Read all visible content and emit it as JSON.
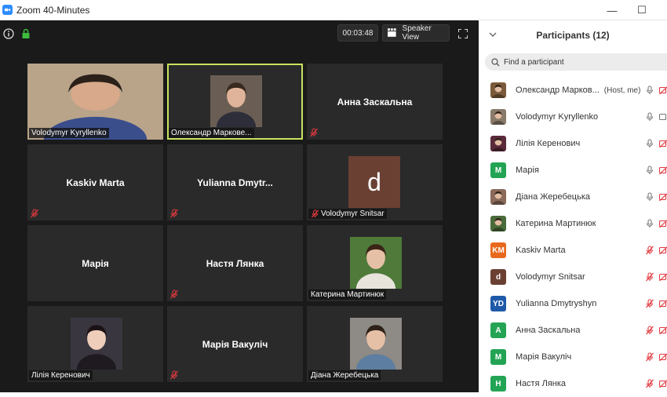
{
  "window": {
    "title": "Zoom 40-Minutes",
    "minimize_glyph": "—",
    "maximize_glyph": "☐"
  },
  "meeting": {
    "timer": "00:03:48",
    "speaker_view_label": "Speaker View"
  },
  "tiles": [
    {
      "name": "Volodymyr Kyryllenko",
      "style": "photo-large",
      "muted": false,
      "active": false
    },
    {
      "name": "Олександр Маркове...",
      "style": "photo-small",
      "muted": false,
      "active": true
    },
    {
      "name": "Анна Заскальна",
      "style": "name",
      "muted": true,
      "active": false
    },
    {
      "name": "Kaskiv Marta",
      "style": "name",
      "muted": true,
      "active": false
    },
    {
      "name": "Yulianna  Dmytr...",
      "style": "name",
      "muted": true,
      "active": false
    },
    {
      "name": "Volodymyr Snitsar",
      "style": "avatar",
      "avatar_letter": "d",
      "muted": true,
      "active": false
    },
    {
      "name": "Марія",
      "style": "name",
      "muted": false,
      "active": false
    },
    {
      "name": "Настя Лянка",
      "style": "name",
      "muted": true,
      "active": false
    },
    {
      "name": "Катерина Мартинюк",
      "style": "photo-small",
      "muted": false,
      "active": false
    },
    {
      "name": "Лілія Керенович",
      "style": "photo-small",
      "muted": false,
      "active": false
    },
    {
      "name": "Марія Вакуліч",
      "style": "name",
      "muted": true,
      "active": false
    },
    {
      "name": "Діана Жеребецька",
      "style": "photo-small",
      "muted": false,
      "active": false
    }
  ],
  "participants_panel": {
    "title": "Participants (12)",
    "search_placeholder": "Find a participant",
    "participants": [
      {
        "name": "Олександр Марков...",
        "role": "(Host, me)",
        "avatar_type": "photo",
        "avatar_color": "#7a5a3a",
        "mic": "on"
      },
      {
        "name": "Volodymyr Kyryllenko",
        "role": "",
        "avatar_type": "photo",
        "avatar_color": "#8a7a6a",
        "mic": "on"
      },
      {
        "name": "Лілія Керенович",
        "role": "",
        "avatar_type": "photo",
        "avatar_color": "#5a2a3a",
        "mic": "on"
      },
      {
        "name": "Марія",
        "role": "",
        "avatar_type": "letter",
        "avatar_text": "M",
        "avatar_color": "#23a455",
        "mic": "on"
      },
      {
        "name": "Діана Жеребецька",
        "role": "",
        "avatar_type": "photo",
        "avatar_color": "#8a6a5a",
        "mic": "on"
      },
      {
        "name": "Катерина Мартинюк",
        "role": "",
        "avatar_type": "photo",
        "avatar_color": "#4a6a3a",
        "mic": "on"
      },
      {
        "name": "Kaskiv Marta",
        "role": "",
        "avatar_type": "letter",
        "avatar_text": "KM",
        "avatar_color": "#e8691d",
        "mic": "muted"
      },
      {
        "name": "Volodymyr Snitsar",
        "role": "",
        "avatar_type": "letter",
        "avatar_text": "d",
        "avatar_color": "#6a4033",
        "mic": "muted"
      },
      {
        "name": "Yulianna Dmytryshyn",
        "role": "",
        "avatar_type": "letter",
        "avatar_text": "YD",
        "avatar_color": "#1f5aa8",
        "mic": "muted"
      },
      {
        "name": "Анна Заскальна",
        "role": "",
        "avatar_type": "letter",
        "avatar_text": "A",
        "avatar_color": "#23a455",
        "mic": "muted"
      },
      {
        "name": "Марія Вакуліч",
        "role": "",
        "avatar_type": "letter",
        "avatar_text": "M",
        "avatar_color": "#23a455",
        "mic": "muted"
      },
      {
        "name": "Настя Лянка",
        "role": "",
        "avatar_type": "letter",
        "avatar_text": "H",
        "avatar_color": "#23a455",
        "mic": "muted"
      }
    ]
  },
  "colors": {
    "muted_red": "#e0393e",
    "active_outline": "#c8e35e",
    "zoom_blue": "#2d8cff"
  }
}
